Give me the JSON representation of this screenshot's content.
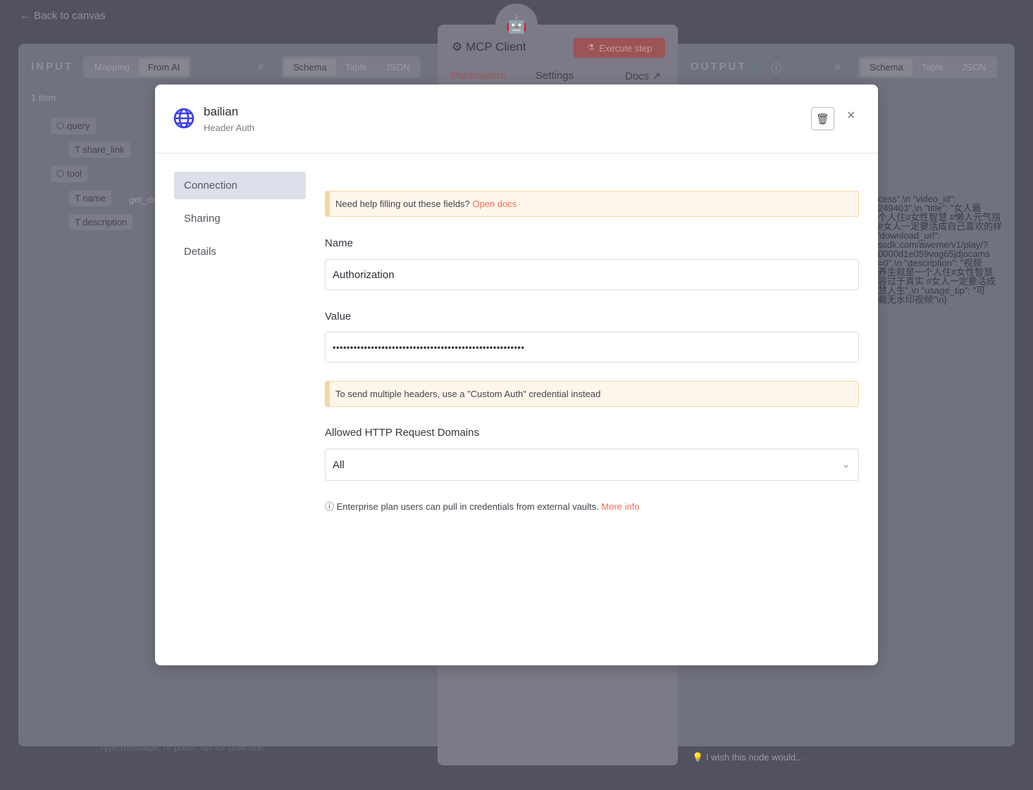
{
  "topbar": {
    "back_label": "Back to canvas"
  },
  "input_panel": {
    "title": "INPUT",
    "mode_tabs": [
      "Mapping",
      "From AI"
    ],
    "active_mode": "From AI",
    "view_tabs": [
      "Schema",
      "Table",
      "JSON"
    ],
    "active_view": "Schema",
    "item_count": "1 item",
    "fields": [
      {
        "name": "query",
        "type": "object"
      },
      {
        "name": "share_link",
        "type": "string"
      },
      {
        "name": "tool",
        "type": "object"
      },
      {
        "name": "name",
        "type": "string",
        "value": "get_do"
      },
      {
        "name": "description",
        "type": "string"
      }
    ]
  },
  "node": {
    "title": "MCP Client",
    "execute_label": "Execute step",
    "tabs": [
      "Parameters",
      "Settings",
      "Docs"
    ],
    "active_tab": "Parameters"
  },
  "output_panel": {
    "title": "OUTPUT",
    "view_tabs": [
      "Schema",
      "Table",
      "JSON"
    ],
    "active_view": "Schema",
    "text_lines": [
      "cess\",\\n \"video_id\":",
      "249403\",\\n \"title\": \"女人最",
      "个人住#女性智慧 #懒人元气指",
      "#女人一定要活成自己喜欢的样",
      "'download_url\":",
      "ssdk.com/aweme/v1/play/?",
      "0000d1e059vog65jdjocams",
      "=0\",\\n \"description\": \"视频",
      "养生就是一个人住#女性智慧",
      "容过于真实 #女人一定要活成",
      "慧人生\",\\n \"usage_tip\": \"可",
      "载无水印视频\"\\n}"
    ]
  },
  "feedback": {
    "placeholder": "I wish this node would..."
  },
  "chat": {
    "placeholder": "Type message, or press 'up' for prev one"
  },
  "modal": {
    "credential_name": "bailian",
    "credential_type": "Header Auth",
    "nav": [
      {
        "label": "Connection",
        "active": true
      },
      {
        "label": "Sharing"
      },
      {
        "label": "Details"
      }
    ],
    "help_text": "Need help filling out these fields?",
    "help_link": "Open docs",
    "name_label": "Name",
    "name_value": "Authorization",
    "value_label": "Value",
    "value_masked": "•••••••••••••••••••••••••••••••••••••••••••••••••••••••",
    "multi_header_note": "To send multiple headers, use a \"Custom Auth\" credential instead",
    "domains_label": "Allowed HTTP Request Domains",
    "domains_value": "All",
    "enterprise_text": "Enterprise plan users can pull in credentials from external vaults.",
    "enterprise_link": "More info"
  },
  "colors": {
    "accent": "#ff6d5a",
    "globe": "#3b3fe0",
    "notice_bg": "#fef6ea",
    "notice_border": "#f4d7a6"
  }
}
